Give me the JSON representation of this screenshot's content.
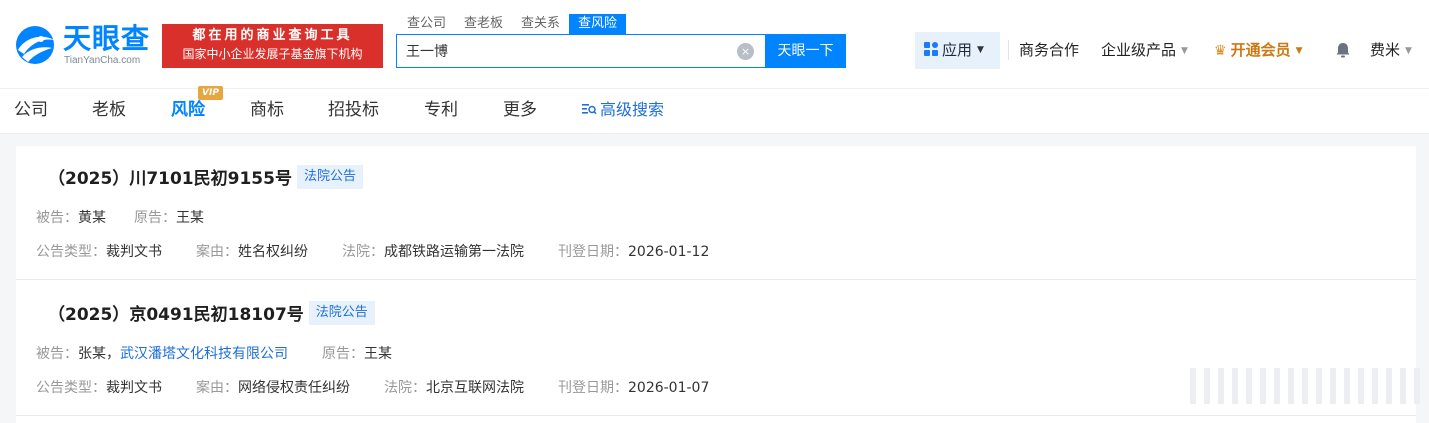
{
  "logo": {
    "cn": "天眼查",
    "en": "TianYanCha.com"
  },
  "slogan": {
    "line1": "都在用的商业查询工具",
    "line2": "国家中小企业发展子基金旗下机构"
  },
  "search_tabs": [
    "查公司",
    "查老板",
    "查关系",
    "查风险"
  ],
  "search": {
    "value": "王一博",
    "button": "天眼一下",
    "clear_symbol": "×"
  },
  "header": {
    "apps": "应用",
    "business": "商务合作",
    "enterprise": "企业级产品",
    "vip": "开通会员",
    "user": "费米",
    "caret": "▼",
    "crown": "♛"
  },
  "nav": {
    "items": [
      "公司",
      "老板",
      "风险",
      "商标",
      "招投标",
      "专利",
      "更多"
    ],
    "active": "风险",
    "vip_badge": "VIP",
    "advanced": "高级搜索"
  },
  "cards": [
    {
      "title": "（2025）川7101民初9155号",
      "tag": "法院公告",
      "defendant_label": "被告：",
      "defendant": "黄某",
      "plaintiff_label": "原告：",
      "plaintiff": "王某",
      "type_label": "公告类型：",
      "type": "裁判文书",
      "cause_label": "案由：",
      "cause": "姓名权纠纷",
      "court_label": "法院：",
      "court": "成都铁路运输第一法院",
      "date_label": "刊登日期：",
      "date": "2026-01-12"
    },
    {
      "title": "（2025）京0491民初18107号",
      "tag": "法院公告",
      "defendant_label": "被告：",
      "defendant": "张某，",
      "defendant_link": "武汉潘塔文化科技有限公司",
      "plaintiff_label": "原告：",
      "plaintiff": "王某",
      "type_label": "公告类型：",
      "type": "裁判文书",
      "cause_label": "案由：",
      "cause": "网络侵权责任纠纷",
      "court_label": "法院：",
      "court": "北京互联网法院",
      "date_label": "刊登日期：",
      "date": "2026-01-07"
    }
  ],
  "colors": {
    "brand": "#0084ff",
    "slogan_bg": "#d9302b",
    "vip": "#ca7a15",
    "link": "#1e6fd8"
  }
}
